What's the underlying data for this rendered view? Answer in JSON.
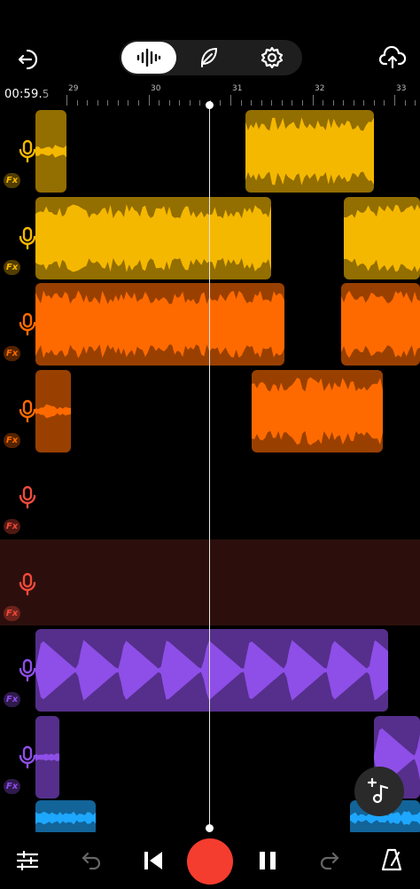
{
  "header": {
    "back_icon": "exit-icon",
    "segments": [
      {
        "icon": "waveform-icon",
        "active": true
      },
      {
        "icon": "feather-icon",
        "active": false
      },
      {
        "icon": "gear-icon",
        "active": false
      }
    ],
    "upload_icon": "cloud-upload-icon"
  },
  "timeline": {
    "time_main": "00:59.",
    "time_fraction": "5",
    "bar_numbers": [
      "29",
      "30",
      "31",
      "32",
      "33"
    ]
  },
  "tracks": [
    {
      "color": "#f5b800",
      "fx_label": "Fx"
    },
    {
      "color": "#f5b800",
      "fx_label": "Fx"
    },
    {
      "color": "#ff6a00",
      "fx_label": "Fx"
    },
    {
      "color": "#ff6a00",
      "fx_label": "Fx"
    },
    {
      "color": "#f04a3a",
      "fx_label": "Fx"
    },
    {
      "color": "#f04a3a",
      "fx_label": "Fx",
      "armed": true
    },
    {
      "color": "#8e4ee8",
      "fx_label": "Fx"
    },
    {
      "color": "#8e4ee8",
      "fx_label": "Fx"
    }
  ],
  "transport": {
    "mixer_icon": "sliders-icon",
    "undo_icon": "undo-icon",
    "rewind_icon": "skip-back-icon",
    "record_icon": "record-icon",
    "pause_icon": "pause-icon",
    "redo_icon": "redo-icon",
    "metronome_icon": "metronome-icon",
    "add_track_icon": "add-music-icon"
  },
  "colors": {
    "yellow": "#f5b800",
    "orange": "#ff6a00",
    "red": "#f04a3a",
    "purple": "#8e4ee8",
    "blue": "#1ea7ff",
    "record": "#f43d2f"
  }
}
